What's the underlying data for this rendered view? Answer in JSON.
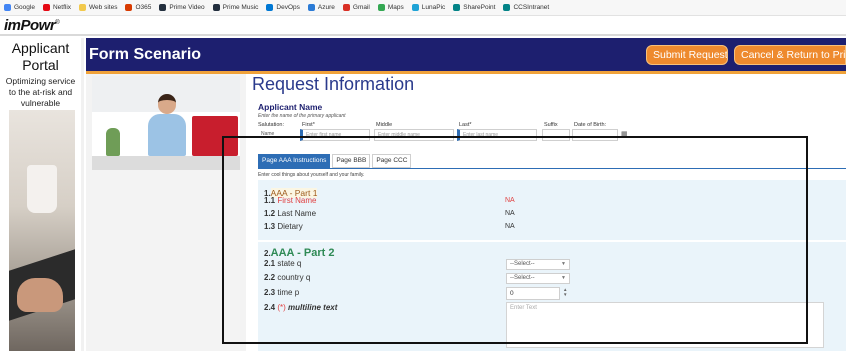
{
  "bookmarks": [
    {
      "label": "Google",
      "icon": "google-icon",
      "color": "#4285f4"
    },
    {
      "label": "Netflix",
      "icon": "netflix-icon",
      "color": "#e50914"
    },
    {
      "label": "Web sites",
      "icon": "folder-icon",
      "color": "#f2c94c"
    },
    {
      "label": "O365",
      "icon": "office-icon",
      "color": "#d83b01"
    },
    {
      "label": "Prime Video",
      "icon": "amazon-icon",
      "color": "#232f3e"
    },
    {
      "label": "Prime Music",
      "icon": "amazon-icon",
      "color": "#232f3e"
    },
    {
      "label": "DevOps",
      "icon": "devops-icon",
      "color": "#0078d4"
    },
    {
      "label": "Azure",
      "icon": "azure-icon",
      "color": "#2b7bd6"
    },
    {
      "label": "Gmail",
      "icon": "gmail-icon",
      "color": "#d93025"
    },
    {
      "label": "Maps",
      "icon": "maps-icon",
      "color": "#34a853"
    },
    {
      "label": "LunaPic",
      "icon": "lunapic-icon",
      "color": "#1fa3d6"
    },
    {
      "label": "SharePoint",
      "icon": "sharepoint-icon",
      "color": "#038387"
    },
    {
      "label": "CCSIntranet",
      "icon": "sharepoint-icon",
      "color": "#038387"
    }
  ],
  "brand": {
    "logo": "imPowr",
    "tm": "®"
  },
  "sidebar": {
    "title": "Applicant Portal",
    "tagline": "Optimizing service to the at-risk and vulnerable"
  },
  "header": {
    "title": "Form Scenario",
    "submit": "Submit Request",
    "cancel": "Cancel & Return to Prio"
  },
  "colors": {
    "header": "#1d1f6f",
    "accent": "#ee8a2e",
    "tab_active": "#2d6db5",
    "panel": "#eaf4fa"
  },
  "form": {
    "title": "Request Information",
    "applicant_label": "Applicant Name",
    "applicant_sub": "Enter the name of the primary applicant",
    "fields": [
      {
        "label": "Salutation:",
        "placeholder": "Name"
      },
      {
        "label": "First*",
        "placeholder": "Enter first name"
      },
      {
        "label": "Middle",
        "placeholder": "Enter middle name"
      },
      {
        "label": "Last*",
        "placeholder": "Enter last name"
      },
      {
        "label": "Suffix",
        "placeholder": ""
      },
      {
        "label": "Date of Birth:",
        "placeholder": ""
      }
    ],
    "tabs": [
      "Page AAA Instructions",
      "Page BBB",
      "Page CCC"
    ],
    "intro": "Enter cool things about yourself and your family.",
    "section1": {
      "num": "1.",
      "title": "AAA - Part 1"
    },
    "rows1": [
      {
        "num": "1.1",
        "label": "First Name",
        "value": "NA"
      },
      {
        "num": "1.2",
        "label": "Last Name",
        "value": "NA"
      },
      {
        "num": "1.3",
        "label": "Dietary",
        "value": "NA"
      }
    ],
    "section2": {
      "num": "2.",
      "title": "AAA - Part 2"
    },
    "rows2": [
      {
        "num": "2.1",
        "label": "state q",
        "value": "--Select--"
      },
      {
        "num": "2.2",
        "label": "country q",
        "value": "--Select--"
      },
      {
        "num": "2.3",
        "label": "time p",
        "value": "0"
      }
    ],
    "multiline": {
      "num": "2.4",
      "req": "(*)",
      "label": "multiline text",
      "placeholder": "Enter Text"
    }
  }
}
